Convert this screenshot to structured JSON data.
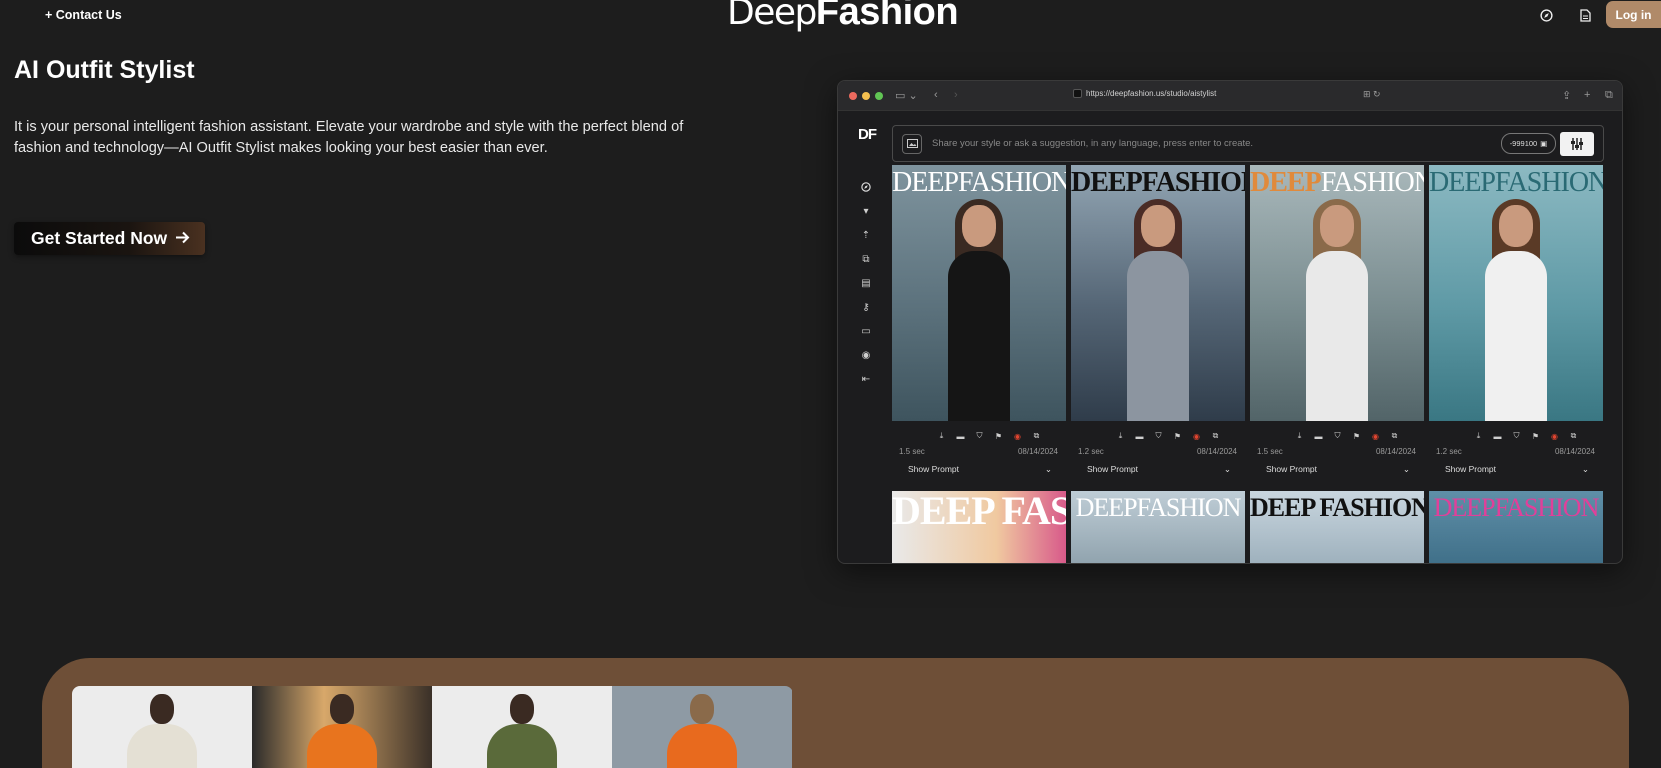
{
  "header": {
    "contact_label": "+ Contact Us",
    "logo_light": "Deep",
    "logo_bold": "Fashion",
    "login_label": "Log in",
    "icons": [
      "compass-icon",
      "document-icon"
    ]
  },
  "hero": {
    "title": "AI Outfit Stylist",
    "description": "It is your personal intelligent fashion assistant. Elevate your wardrobe and style with the perfect blend of fashion and technology—AI Outfit Stylist makes looking your best easier than ever.",
    "cta_label": "Get Started Now"
  },
  "browser": {
    "url": "https://deepfashion.us/studio/aistylist",
    "app_logo": "DF",
    "prompt_placeholder": "Share your style or ask a suggestion, in any language, press enter to create.",
    "seed_value": "-999100",
    "sidebar_icons": [
      "compass-icon",
      "brush-icon",
      "upload-icon",
      "gallery-icon",
      "book-icon",
      "key-icon",
      "card-icon",
      "user-icon",
      "logout-icon"
    ],
    "cards": [
      {
        "masthead": "DEEPFASHION",
        "time": "1.5 sec",
        "date": "08/14/2024",
        "show_prompt": "Show Prompt"
      },
      {
        "masthead": "DEEPFASHION",
        "time": "1.2 sec",
        "date": "08/14/2024",
        "show_prompt": "Show Prompt"
      },
      {
        "masthead": "DEEPFASHION",
        "time": "1.5 sec",
        "date": "08/14/2024",
        "show_prompt": "Show Prompt"
      },
      {
        "masthead": "DEEPFASHION",
        "time": "1.2 sec",
        "date": "08/14/2024",
        "show_prompt": "Show Prompt"
      }
    ],
    "second_row": [
      {
        "masthead": "DEEP FASHION"
      },
      {
        "masthead": "DEEPFASHION"
      },
      {
        "masthead": "DEEP FASHION"
      },
      {
        "masthead": "DEEPFASHION"
      }
    ]
  },
  "colors": {
    "background": "#1d1d1d",
    "accent": "#b08a69",
    "brown_section": "#6e4f37"
  }
}
